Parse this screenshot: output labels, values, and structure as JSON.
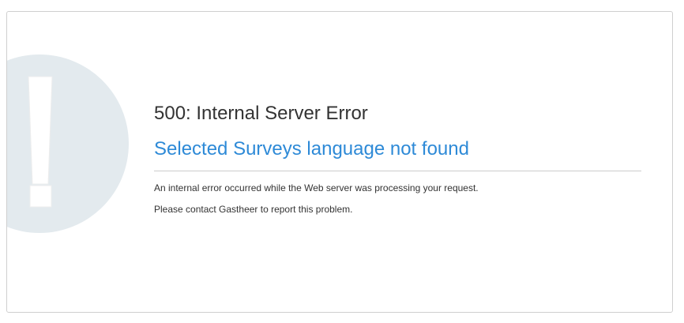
{
  "error": {
    "code_text": "500: Internal Server Error",
    "title": "Selected Surveys language not found",
    "messages": [
      "An internal error occurred while the Web server was processing your request.",
      "Please contact Gastheer to report this problem."
    ]
  },
  "colors": {
    "title": "#2e8ad7",
    "text": "#333333",
    "graphic_circle": "#e3eaee",
    "panel_border": "#cfcfcf"
  },
  "icons": {
    "alert": "exclamation-circle-icon"
  }
}
